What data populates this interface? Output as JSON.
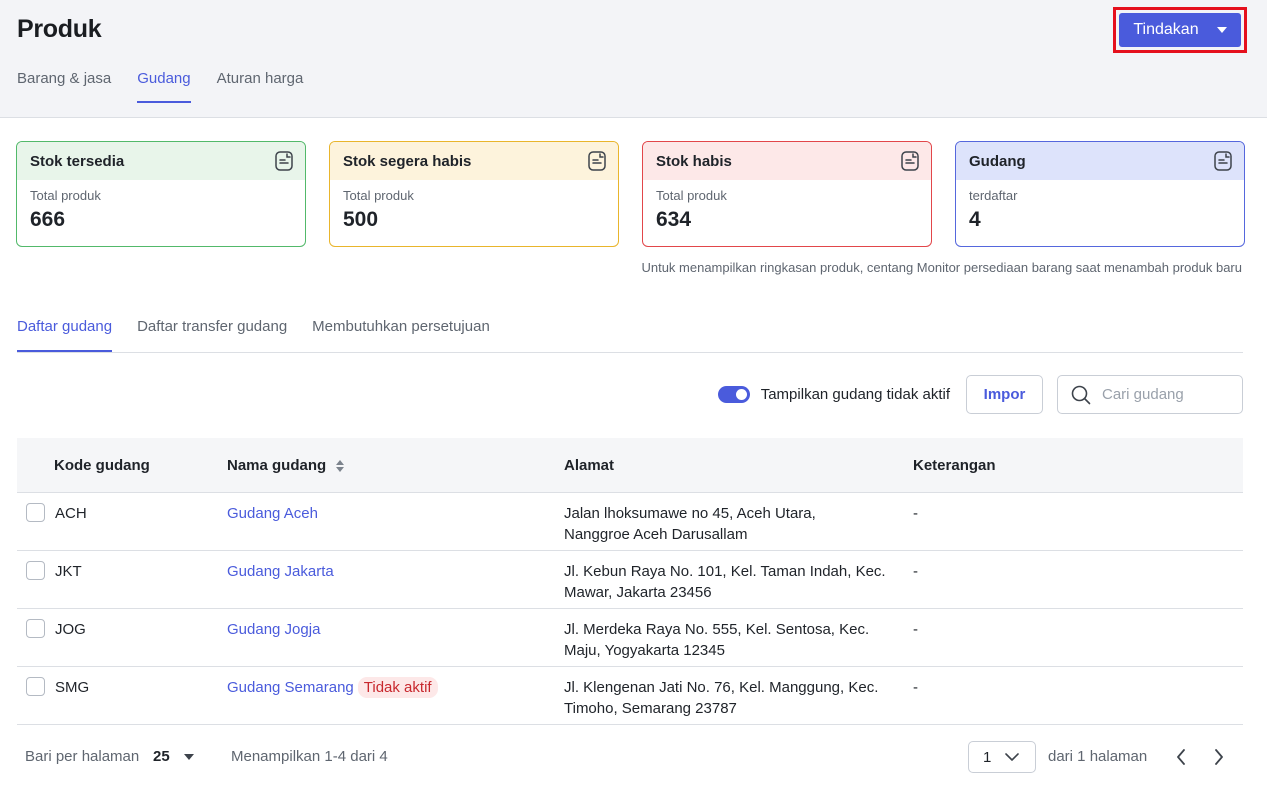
{
  "header": {
    "title": "Produk",
    "action_label": "Tindakan",
    "tabs": [
      {
        "label": "Barang & jasa",
        "active": false
      },
      {
        "label": "Gudang",
        "active": true
      },
      {
        "label": "Aturan harga",
        "active": false
      }
    ]
  },
  "summary_cards": [
    {
      "title": "Stok tersedia",
      "subtitle": "Total produk",
      "value": "666",
      "color": "#52b96a",
      "icon": "document-icon"
    },
    {
      "title": "Stok segera habis",
      "subtitle": "Total produk",
      "value": "500",
      "color": "#e9b52c",
      "icon": "document-icon"
    },
    {
      "title": "Stok habis",
      "subtitle": "Total produk",
      "value": "634",
      "color": "#e2464a",
      "icon": "document-icon"
    },
    {
      "title": "Gudang",
      "subtitle": "terdaftar",
      "value": "4",
      "color": "#5567dd",
      "icon": "document-icon"
    }
  ],
  "hint": "Untuk menampilkan ringkasan produk, centang Monitor persediaan barang saat menambah produk baru",
  "sub_tabs": [
    {
      "label": "Daftar gudang",
      "active": true
    },
    {
      "label": "Daftar transfer gudang",
      "active": false
    },
    {
      "label": "Membutuhkan persetujuan",
      "active": false
    }
  ],
  "toolbar": {
    "toggle_label": "Tampilkan gudang tidak aktif",
    "toggle_on": true,
    "import_label": "Impor",
    "search_placeholder": "Cari gudang"
  },
  "table": {
    "columns": [
      "Kode gudang",
      "Nama gudang",
      "Alamat",
      "Keterangan"
    ],
    "rows": [
      {
        "code": "ACH",
        "name": "Gudang Aceh",
        "badge": "",
        "address_1": "Jalan lhoksumawe no 45, Aceh Utara,",
        "address_2": "Nanggroe Aceh Darusallam",
        "note": "-"
      },
      {
        "code": "JKT",
        "name": "Gudang Jakarta",
        "badge": "",
        "address_1": "Jl. Kebun Raya No. 101, Kel. Taman Indah, Kec.",
        "address_2": "Mawar, Jakarta 23456",
        "note": "-"
      },
      {
        "code": "JOG",
        "name": "Gudang Jogja",
        "badge": "",
        "address_1": "Jl. Merdeka Raya No. 555, Kel. Sentosa, Kec.",
        "address_2": "Maju, Yogyakarta 12345",
        "note": "-"
      },
      {
        "code": "SMG",
        "name": "Gudang Semarang",
        "badge": "Tidak aktif",
        "address_1": "Jl. Klengenan Jati No. 76, Kel. Manggung, Kec.",
        "address_2": "Timoho, Semarang 23787",
        "note": "-"
      }
    ]
  },
  "footer": {
    "rows_per_page_label": "Bari per halaman",
    "rows_per_page_value": "25",
    "showing": "Menampilkan 1-4 dari 4",
    "page_value": "1",
    "of_pages": "dari 1 halaman"
  }
}
